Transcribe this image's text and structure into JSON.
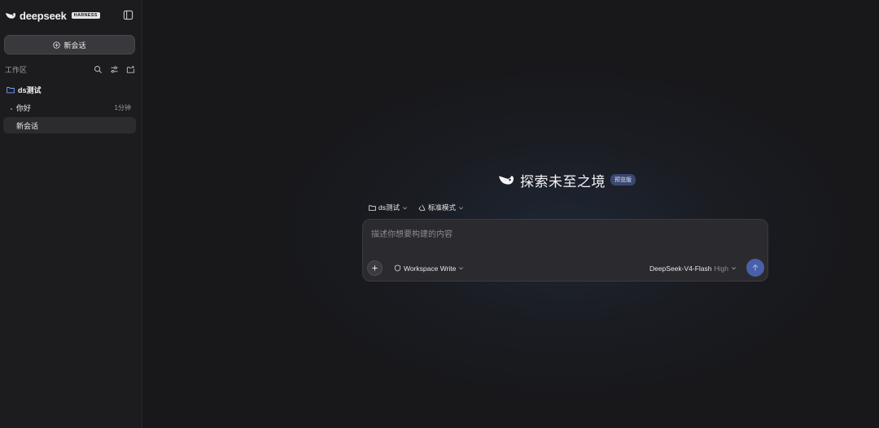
{
  "brand": {
    "name": "deepseek",
    "badge": "HARNESS"
  },
  "sidebar": {
    "new_chat_label": "新会话",
    "workspace_label": "工作区",
    "folder_name": "ds测试",
    "chats": [
      {
        "title": "你好",
        "time": "1分钟"
      },
      {
        "title": "新会话",
        "time": ""
      }
    ]
  },
  "hero": {
    "title": "探索未至之境",
    "badge": "预览版"
  },
  "selectors": {
    "workspace": "ds测试",
    "mode": "标准模式"
  },
  "composer": {
    "placeholder": "描述你想要构建的内容",
    "value": "",
    "permission": "Workspace Write",
    "model": "DeepSeek-V4-Flash",
    "effort": "High"
  },
  "icons": {
    "collapse": "sidebar-toggle-icon",
    "new_chat": "plus-circle-icon",
    "search": "search-icon",
    "filter": "sliders-icon",
    "new_folder": "folder-plus-icon",
    "folder": "folder-icon",
    "mode": "recycle-icon",
    "permission": "shield-icon",
    "attach": "plus-icon",
    "send": "arrow-up-icon"
  },
  "colors": {
    "accent": "#4a5fa8",
    "badge_bg": "#3a4770",
    "folder_icon": "#7b9cff"
  }
}
